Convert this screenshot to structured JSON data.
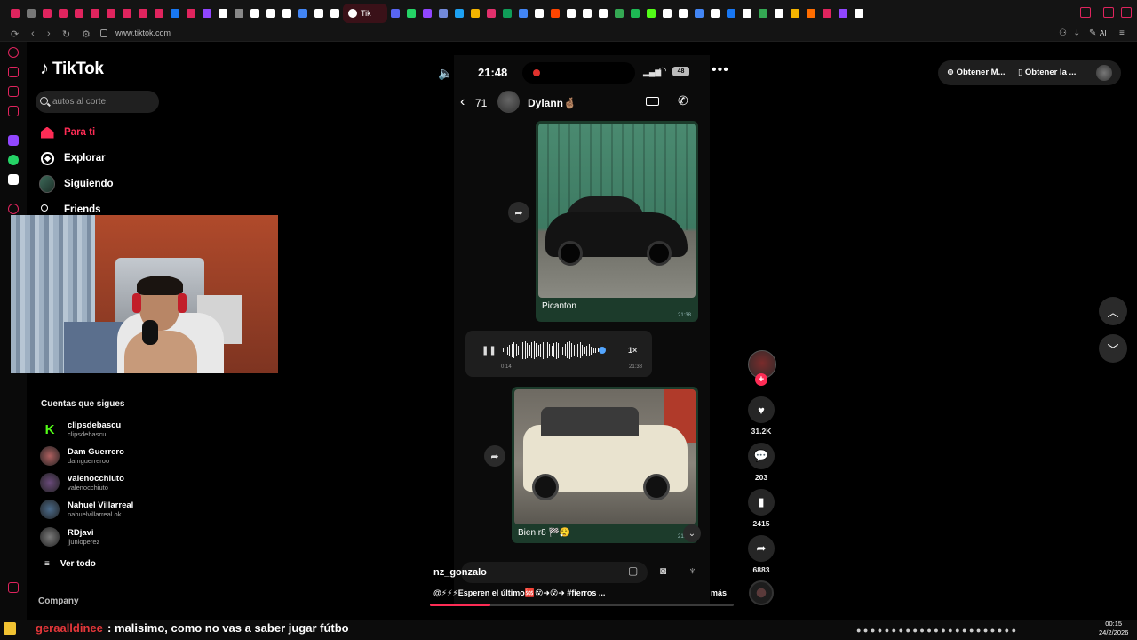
{
  "browser": {
    "url": "www.tiktok.com",
    "active_tab_label": "Tik",
    "ai_label": "AI",
    "tab_colors": [
      "#e0245e",
      "#777",
      "#e0245e",
      "#e0245e",
      "#e0245e",
      "#e0245e",
      "#e0245e",
      "#e0245e",
      "#e0245e",
      "#e0245e",
      "#1877f2",
      "#e0245e",
      "#9146ff",
      "#fff",
      "#888",
      "#fff",
      "#fff",
      "#fff",
      "#4285f4",
      "#fff",
      "#fff",
      "#5865f2",
      "#25d366",
      "#9146ff",
      "#7289da",
      "#1da1f2",
      "#f4b400",
      "#e1306c",
      "#0f9d58",
      "#4285f4",
      "#fff",
      "#ff4500",
      "#fff",
      "#fff",
      "#fff",
      "#34a853",
      "#1db954",
      "#53fc18",
      "#fff",
      "#fff",
      "#4285f4",
      "#fff",
      "#1877f2",
      "#fff",
      "#34a853",
      "#fff",
      "#f4b400",
      "#ff6d00",
      "#e0245e",
      "#9146ff",
      "#fff"
    ]
  },
  "sidebar": {
    "logo": "TikTok",
    "search_placeholder": "autos al corte",
    "nav": [
      {
        "label": "Para ti",
        "icon": "home-icon"
      },
      {
        "label": "Explorar",
        "icon": "compass-icon"
      },
      {
        "label": "Siguiendo",
        "icon": "following-avatar"
      },
      {
        "label": "Friends",
        "icon": "friends-icon"
      }
    ],
    "following_title": "Cuentas que sigues",
    "accounts": [
      {
        "name": "clipsdebascu",
        "handle": "clipsdebascu",
        "color": "#53fc18"
      },
      {
        "name": "Dam Guerrero",
        "handle": "damguerreroo",
        "color": "#b06060"
      },
      {
        "name": "valenocchiuto",
        "handle": "valenocchiuto",
        "color": "#6a4a7a"
      },
      {
        "name": "Nahuel Villarreal",
        "handle": "nahuelvillarreal.ok",
        "color": "#4a6a8a"
      },
      {
        "name": "RDjavi",
        "handle": "jjunloperez",
        "color": "#7a7a7a"
      }
    ],
    "see_all": "Ver todo",
    "company": "Company"
  },
  "video": {
    "phone_time": "21:48",
    "battery": "48",
    "chat_back_count": "71",
    "chat_name": "Dylann🤞🏽",
    "msg1_caption": "Picanton",
    "msg1_time": "21:38",
    "voice_elapsed": "0:14",
    "voice_time": "21:38",
    "voice_speed": "1×",
    "msg2_caption": "Bien r8 🏁😮‍💨",
    "msg2_time": "21:39",
    "author": "nz_gonzalo",
    "description": "@⚡⚡⚡Esperen el último🆘😵➜😵➜ #fierros ...",
    "more": "más",
    "progress": 0.2
  },
  "actions": {
    "likes": "31.2K",
    "comments": "203",
    "saves": "2415",
    "shares": "6883"
  },
  "top_right": {
    "get_coins": "Obtener M...",
    "get_app": "Obtener la ..."
  },
  "stream_chat": {
    "user": "geraalldinee",
    "message": ": malisimo, como no vas a saber jugar fútbo"
  },
  "clock": {
    "time": "00:15",
    "date": "24/2/2026"
  }
}
